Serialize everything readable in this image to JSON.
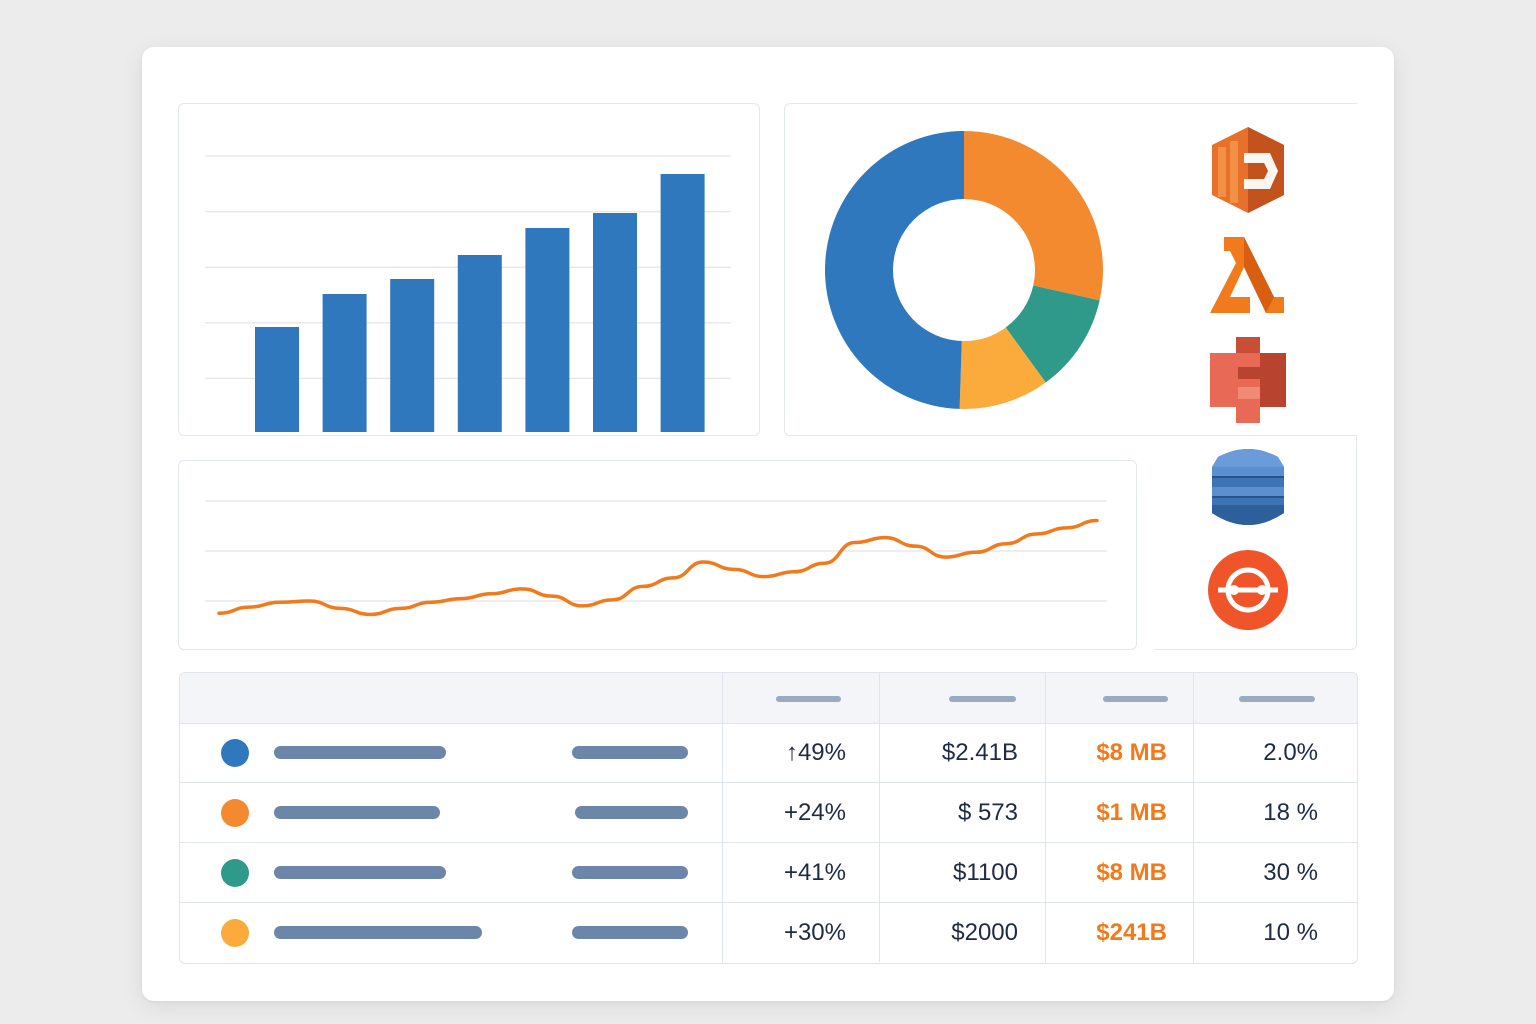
{
  "colors": {
    "blue": "#2f78bd",
    "orange": "#f48a2f",
    "teal": "#2f9a8a",
    "yellow": "#fbab3b",
    "bar": "#2f78bd",
    "line": "#f07a1c",
    "text": "#1f2a44",
    "accent_orange_text": "#f07a1c"
  },
  "icons": [
    {
      "name": "aws-compute-icon",
      "color": "#e8702a"
    },
    {
      "name": "aws-lambda-icon",
      "color": "#f07a1c"
    },
    {
      "name": "aws-s3-icon",
      "color": "#e05a43"
    },
    {
      "name": "aws-dynamodb-icon",
      "color": "#3a70b0"
    },
    {
      "name": "aws-globe-service-icon",
      "color": "#f0552a"
    }
  ],
  "chart_data": [
    {
      "type": "bar",
      "categories": [
        "",
        "",
        "",
        "",
        "",
        "",
        ""
      ],
      "values": [
        17.5,
        23,
        25.5,
        29.5,
        34,
        36.5,
        43
      ],
      "ylim": [
        0,
        50
      ],
      "grid": true,
      "title": "",
      "xlabel": "",
      "ylabel": ""
    },
    {
      "type": "pie",
      "donut": true,
      "values": [
        28.5,
        11.5,
        10.5,
        49.5
      ],
      "slice_colors": [
        "#f48a2f",
        "#2f9a8a",
        "#fbab3b",
        "#2f78bd"
      ]
    },
    {
      "type": "line",
      "x": [
        0,
        1,
        2,
        3,
        4,
        5,
        6,
        7,
        8,
        9,
        10,
        11,
        12,
        13,
        14,
        15,
        16,
        17,
        18,
        19,
        20,
        21,
        22,
        23,
        24,
        25,
        26,
        27,
        28,
        29
      ],
      "series": [
        {
          "values": [
            8,
            13,
            17,
            18,
            12,
            7,
            12,
            17,
            20,
            24,
            28,
            22,
            14,
            19,
            30,
            37,
            50,
            44,
            38,
            42,
            49,
            66,
            70,
            63,
            54,
            58,
            65,
            73,
            78,
            84
          ]
        }
      ],
      "ylim": [
        0,
        100
      ],
      "grid": true
    }
  ],
  "table": {
    "rows": [
      {
        "dot_color": "#2f78bd",
        "change": "↑49%",
        "amount": "$2.41B",
        "size": "$8 MB",
        "pct": "2.0%"
      },
      {
        "dot_color": "#f48a2f",
        "change": "+24%",
        "amount": "$ 573",
        "size": "$1 MB",
        "pct": "18 %"
      },
      {
        "dot_color": "#2f9a8a",
        "change": "+41%",
        "amount": "$1100",
        "size": "$8 MB",
        "pct": "30 %"
      },
      {
        "dot_color": "#fbab3b",
        "change": "+30%",
        "amount": "$2000",
        "size": "$241B",
        "pct": "10 %"
      }
    ]
  }
}
